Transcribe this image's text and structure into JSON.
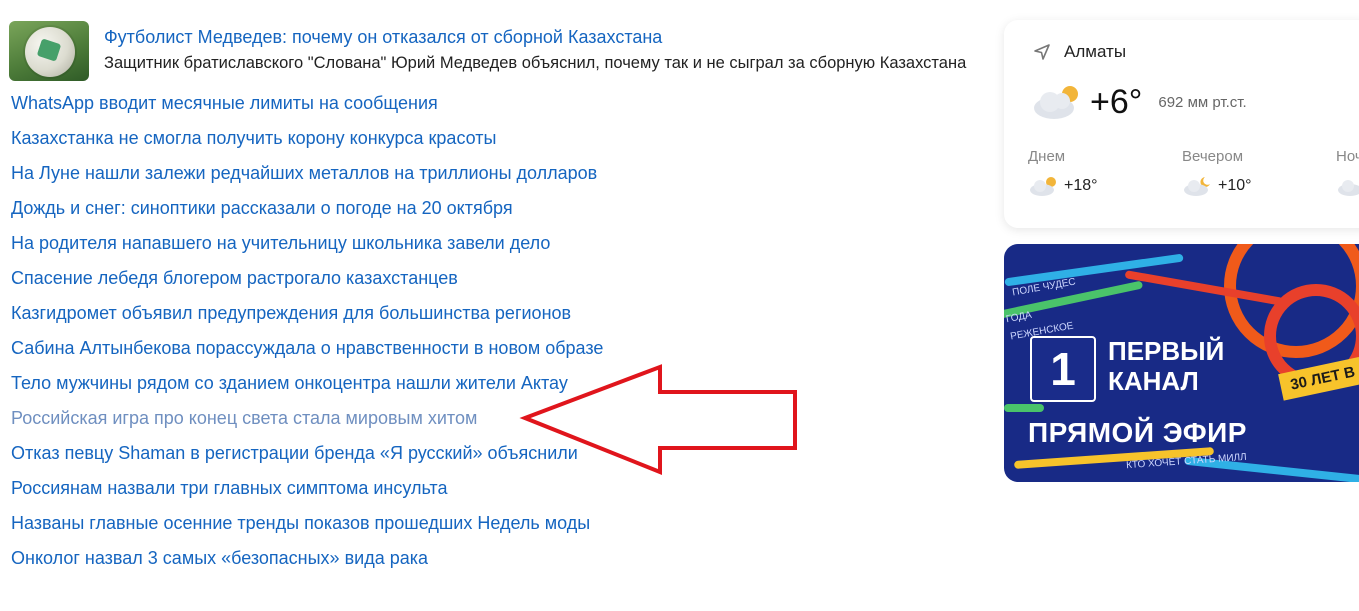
{
  "featured": {
    "title": "Футболист Медведев: почему он отказался от сборной Казахстана",
    "description": "Защитник братиславского \"Слована\" Юрий Медведев объяснил, почему так и не сыграл за сборную Казахстана"
  },
  "news": [
    {
      "title": "WhatsApp вводит месячные лимиты на сообщения",
      "visited": false
    },
    {
      "title": "Казахстанка не смогла получить корону конкурса красоты",
      "visited": false
    },
    {
      "title": "На Луне нашли залежи редчайших металлов на триллионы долларов",
      "visited": false
    },
    {
      "title": "Дождь и снег: синоптики рассказали о погоде на 20 октября",
      "visited": false
    },
    {
      "title": "На родителя напавшего на учительницу школьника завели дело",
      "visited": false
    },
    {
      "title": "Спасение лебедя блогером растрогало казахстанцев",
      "visited": false
    },
    {
      "title": "Казгидромет объявил предупреждения для большинства регионов",
      "visited": false
    },
    {
      "title": "Сабина Алтынбекова порассуждала о нравственности в новом образе",
      "visited": false
    },
    {
      "title": "Тело мужчины рядом со зданием онкоцентра нашли жители Актау",
      "visited": false
    },
    {
      "title": "Российская игра про конец света стала мировым хитом",
      "visited": true
    },
    {
      "title": "Отказ певцу Shaman в регистрации бренда «Я русский» объяснили",
      "visited": false
    },
    {
      "title": "Россиянам назвали три главных симптома инсульта",
      "visited": false
    },
    {
      "title": "Названы главные осенние тренды показов прошедших Недель моды",
      "visited": false
    },
    {
      "title": "Онколог назвал 3 самых «безопасных» вида рака",
      "visited": false
    }
  ],
  "weather": {
    "city": "Алматы",
    "location_icon": "location-arrow-icon",
    "temp_now": "+6°",
    "pressure": "692 мм рт.ст.",
    "parts": [
      {
        "name": "Днем",
        "temp": "+18°",
        "icon": "cloud-sun-icon"
      },
      {
        "name": "Вечером",
        "temp": "+10°",
        "icon": "cloud-moon-icon"
      },
      {
        "name": "Ночью",
        "temp": "",
        "icon": "cloud-icon"
      }
    ]
  },
  "banner": {
    "channel_line1": "ПЕРВЫЙ",
    "channel_line2": "КАНАЛ",
    "live": "ПРЯМОЙ ЭФИР",
    "years": "30 ЛЕТ В",
    "tags": [
      "ПОЛЕ ЧУДЕС",
      "ГОДА",
      "РЕЖЕНСКОЕ",
      "КТО ХОЧЕТ СТАТЬ МИЛЛ"
    ]
  },
  "colors": {
    "link": "#1565c0",
    "visited_link": "#6f8fc0",
    "annotation_arrow": "#e0151c",
    "banner_bg": "#182a86"
  }
}
